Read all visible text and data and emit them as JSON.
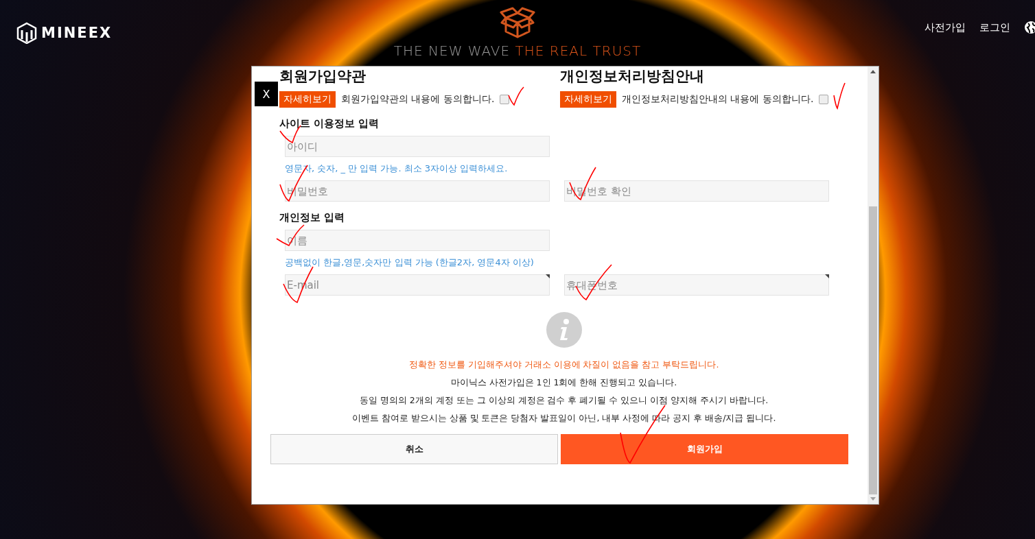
{
  "header": {
    "logo": "MINEEX",
    "nav": [
      {
        "label": "사전가입"
      },
      {
        "label": "로그인"
      }
    ],
    "headline": {
      "lead": "THE NEW WAVE",
      "accent": "THE REAL TRUST"
    }
  },
  "modal": {
    "close": "X",
    "agreements": [
      {
        "title": "회원가입약관",
        "button": "자세히보기",
        "text": "회원가입약관의 내용에 동의합니다.",
        "checked": false
      },
      {
        "title": "개인정보처리방침안내",
        "button": "자세히보기",
        "text": "개인정보처리방침안내의 내용에 동의합니다.",
        "checked": false
      }
    ],
    "sections": [
      {
        "title": "사이트 이용정보 입력",
        "rows": [
          {
            "fields": [
              {
                "placeholder": "아이디",
                "flagged": false
              }
            ],
            "hint": "영문자, 숫자, _ 만 입력 가능. 최소 3자이상 입력하세요."
          },
          {
            "fields": [
              {
                "placeholder": "비밀번호",
                "flagged": false
              },
              {
                "placeholder": "비밀번호 확인",
                "flagged": false
              }
            ]
          }
        ]
      },
      {
        "title": "개인정보 입력",
        "rows": [
          {
            "fields": [
              {
                "placeholder": "이름",
                "flagged": false
              }
            ],
            "hint": "공백없이 한글,영문,숫자만 입력 가능 (한글2자, 영문4자 이상)"
          },
          {
            "fields": [
              {
                "placeholder": "E-mail",
                "flagged": true
              },
              {
                "placeholder": "휴대폰번호",
                "flagged": true
              }
            ]
          }
        ]
      }
    ],
    "notices": [
      {
        "text": "정확한 정보를 기입해주셔야 거래소 이용에 차질이 없음을 참고 부탁드립니다.",
        "kind": "warning"
      },
      {
        "text": "마이닉스 사전가입은 1인 1회에 한해 진행되고 있습니다.",
        "kind": "normal"
      },
      {
        "text": "동일 명의의 2개의 계정 또는 그 이상의 계정은 검수 후 폐기될 수 있으니 이점 양지해 주시기 바랍니다.",
        "kind": "normal"
      },
      {
        "text": "이벤트 참여로 받으시는 상품 및 토큰은 당첨자 발표일이 아닌, 내부 사정에 따라 공지 후 배송/지급 됩니다.",
        "kind": "normal"
      }
    ],
    "buttons": [
      {
        "label": "취소",
        "kind": "secondary"
      },
      {
        "label": "회원가입",
        "kind": "primary"
      }
    ]
  }
}
